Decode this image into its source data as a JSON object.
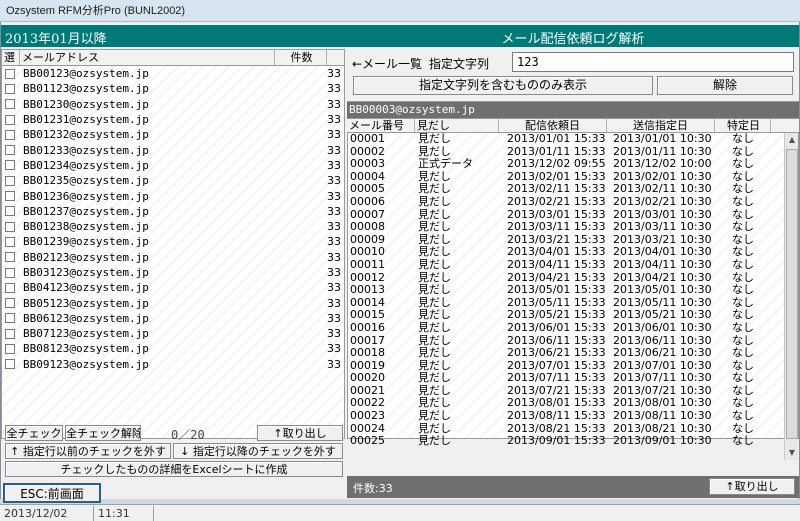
{
  "window": {
    "title": "Ozsystem RFM分析Pro (BUNL2002)"
  },
  "header": {
    "date_label": "2013年01月以降",
    "title": "メール配信依頼ログ解析"
  },
  "mail_list": {
    "columns": {
      "select": "選",
      "address": "メールアドレス",
      "count": "件数"
    },
    "rows": [
      {
        "address": "BB00123@ozsystem.jp",
        "count": "33"
      },
      {
        "address": "BB01123@ozsystem.jp",
        "count": "33"
      },
      {
        "address": "BB01230@ozsystem.jp",
        "count": "33"
      },
      {
        "address": "BB01231@ozsystem.jp",
        "count": "33"
      },
      {
        "address": "BB01232@ozsystem.jp",
        "count": "33"
      },
      {
        "address": "BB01233@ozsystem.jp",
        "count": "33"
      },
      {
        "address": "BB01234@ozsystem.jp",
        "count": "33"
      },
      {
        "address": "BB01235@ozsystem.jp",
        "count": "33"
      },
      {
        "address": "BB01236@ozsystem.jp",
        "count": "33"
      },
      {
        "address": "BB01237@ozsystem.jp",
        "count": "33"
      },
      {
        "address": "BB01238@ozsystem.jp",
        "count": "33"
      },
      {
        "address": "BB01239@ozsystem.jp",
        "count": "33"
      },
      {
        "address": "BB02123@ozsystem.jp",
        "count": "33"
      },
      {
        "address": "BB03123@ozsystem.jp",
        "count": "33"
      },
      {
        "address": "BB04123@ozsystem.jp",
        "count": "33"
      },
      {
        "address": "BB05123@ozsystem.jp",
        "count": "33"
      },
      {
        "address": "BB06123@ozsystem.jp",
        "count": "33"
      },
      {
        "address": "BB07123@ozsystem.jp",
        "count": "33"
      },
      {
        "address": "BB08123@ozsystem.jp",
        "count": "33"
      },
      {
        "address": "BB09123@ozsystem.jp",
        "count": "33"
      }
    ]
  },
  "left_controls": {
    "check_all": "全チェック",
    "uncheck_all": "全チェック解除",
    "selected_count": "0／20",
    "extract": "↑取り出し",
    "uncheck_before": "↑ 指定行以前のチェックを外す",
    "uncheck_after": "↓ 指定行以降のチェックを外す",
    "export_excel": "チェックしたものの詳細をExcelシートに作成"
  },
  "filter": {
    "back_link": "←メール一覧",
    "label": "指定文字列",
    "value": "123",
    "show_matching": "指定文字列を含むもののみ表示",
    "clear": "解除"
  },
  "detail": {
    "selected_address": "BB00003@ozsystem.jp",
    "columns": [
      "メール番号",
      "見だし",
      "配信依頼日",
      "送信指定日",
      "特定日"
    ],
    "rows": [
      [
        "00001",
        "見だし",
        "2013/01/01 15:33",
        "2013/01/01 10:30",
        "なし"
      ],
      [
        "00002",
        "見だし",
        "2013/01/11 15:33",
        "2013/01/11 10:30",
        "なし"
      ],
      [
        "00003",
        "正式データ",
        "2013/12/02 09:55",
        "2013/12/02 10:00",
        "なし"
      ],
      [
        "00004",
        "見だし",
        "2013/02/01 15:33",
        "2013/02/01 10:30",
        "なし"
      ],
      [
        "00005",
        "見だし",
        "2013/02/11 15:33",
        "2013/02/11 10:30",
        "なし"
      ],
      [
        "00006",
        "見だし",
        "2013/02/21 15:33",
        "2013/02/21 10:30",
        "なし"
      ],
      [
        "00007",
        "見だし",
        "2013/03/01 15:33",
        "2013/03/01 10:30",
        "なし"
      ],
      [
        "00008",
        "見だし",
        "2013/03/11 15:33",
        "2013/03/11 10:30",
        "なし"
      ],
      [
        "00009",
        "見だし",
        "2013/03/21 15:33",
        "2013/03/21 10:30",
        "なし"
      ],
      [
        "00010",
        "見だし",
        "2013/04/01 15:33",
        "2013/04/01 10:30",
        "なし"
      ],
      [
        "00011",
        "見だし",
        "2013/04/11 15:33",
        "2013/04/11 10:30",
        "なし"
      ],
      [
        "00012",
        "見だし",
        "2013/04/21 15:33",
        "2013/04/21 10:30",
        "なし"
      ],
      [
        "00013",
        "見だし",
        "2013/05/01 15:33",
        "2013/05/01 10:30",
        "なし"
      ],
      [
        "00014",
        "見だし",
        "2013/05/11 15:33",
        "2013/05/11 10:30",
        "なし"
      ],
      [
        "00015",
        "見だし",
        "2013/05/21 15:33",
        "2013/05/21 10:30",
        "なし"
      ],
      [
        "00016",
        "見だし",
        "2013/06/01 15:33",
        "2013/06/01 10:30",
        "なし"
      ],
      [
        "00017",
        "見だし",
        "2013/06/11 15:33",
        "2013/06/11 10:30",
        "なし"
      ],
      [
        "00018",
        "見だし",
        "2013/06/21 15:33",
        "2013/06/21 10:30",
        "なし"
      ],
      [
        "00019",
        "見だし",
        "2013/07/01 15:33",
        "2013/07/01 10:30",
        "なし"
      ],
      [
        "00020",
        "見だし",
        "2013/07/11 15:33",
        "2013/07/11 10:30",
        "なし"
      ],
      [
        "00021",
        "見だし",
        "2013/07/21 15:33",
        "2013/07/21 10:30",
        "なし"
      ],
      [
        "00022",
        "見だし",
        "2013/08/01 15:33",
        "2013/08/01 10:30",
        "なし"
      ],
      [
        "00023",
        "見だし",
        "2013/08/11 15:33",
        "2013/08/11 10:30",
        "なし"
      ],
      [
        "00024",
        "見だし",
        "2013/08/21 15:33",
        "2013/08/21 10:30",
        "なし"
      ],
      [
        "00025",
        "見だし",
        "2013/09/01 15:33",
        "2013/09/01 10:30",
        "なし"
      ]
    ],
    "count_label": "件数:33",
    "extract": "↑取り出し"
  },
  "esc_button": "ESC:前画面",
  "status": {
    "date": "2013/12/02",
    "time": "11:31"
  },
  "colors": {
    "header_bg": "#007a78",
    "panel_bar": "#6f6f6f"
  }
}
